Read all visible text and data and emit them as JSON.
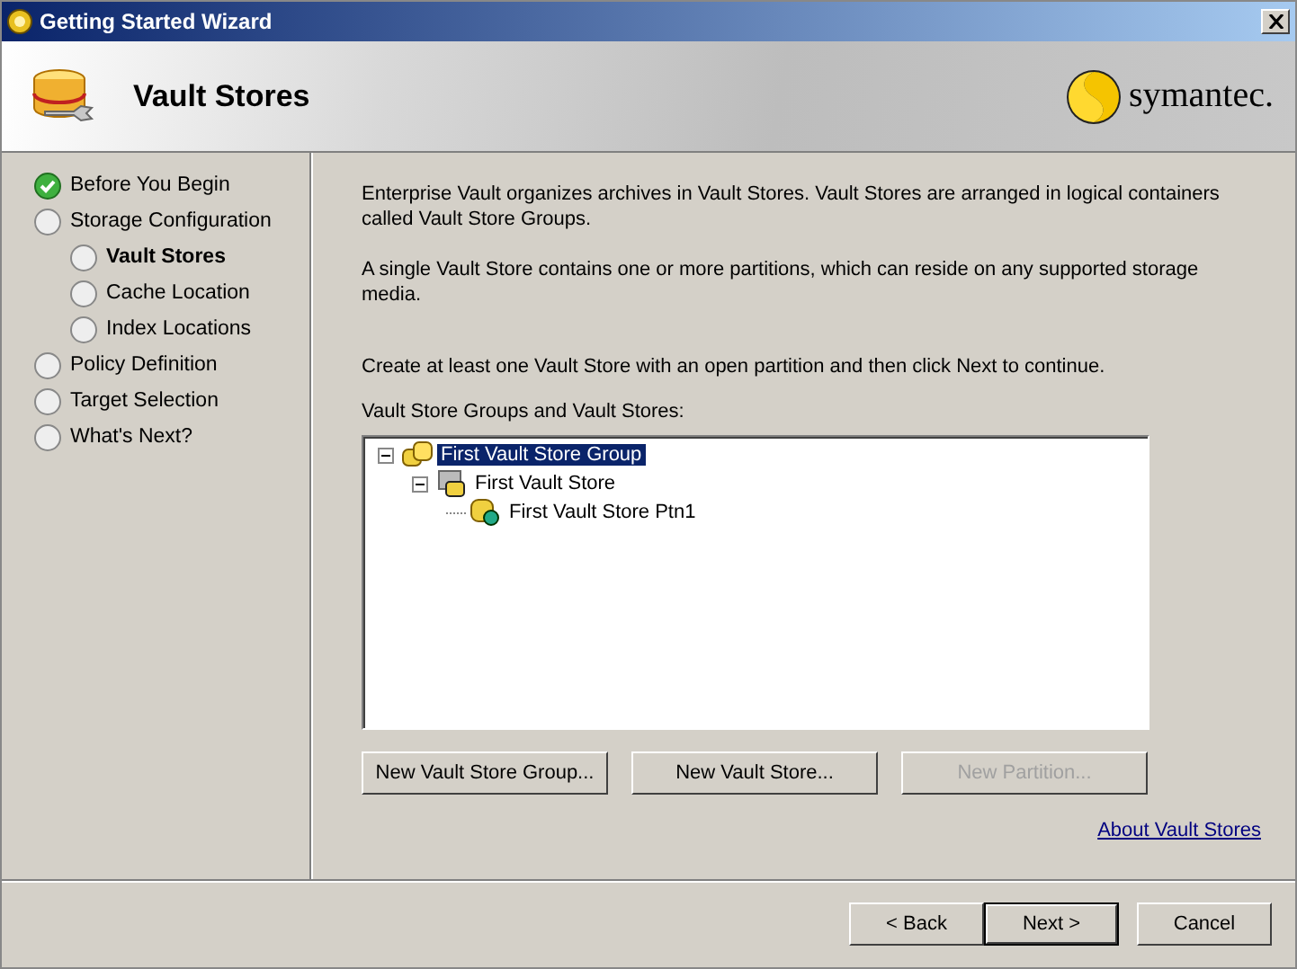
{
  "window": {
    "title": "Getting Started Wizard"
  },
  "header": {
    "title": "Vault Stores",
    "brand": "symantec."
  },
  "steps": [
    {
      "label": "Before You Begin",
      "done": true,
      "current": false
    },
    {
      "label": "Storage Configuration",
      "done": false,
      "current": false,
      "children": [
        {
          "label": "Vault Stores",
          "done": false,
          "current": true
        },
        {
          "label": "Cache Location",
          "done": false,
          "current": false
        },
        {
          "label": "Index Locations",
          "done": false,
          "current": false
        }
      ]
    },
    {
      "label": "Policy Definition",
      "done": false,
      "current": false
    },
    {
      "label": "Target Selection",
      "done": false,
      "current": false
    },
    {
      "label": "What's Next?",
      "done": false,
      "current": false
    }
  ],
  "paragraphs": [
    "Enterprise Vault organizes archives in Vault Stores. Vault Stores are arranged in logical containers called Vault Store Groups.",
    "A single Vault Store contains one or more partitions, which can reside on any supported storage media.",
    "Create at least one Vault Store with an open partition and then click Next to continue."
  ],
  "tree_label": "Vault Store Groups and Vault Stores:",
  "tree": [
    {
      "label": "First Vault Store Group",
      "kind": "group",
      "selected": true,
      "expanded": true,
      "children": [
        {
          "label": "First Vault Store",
          "kind": "store",
          "selected": false,
          "expanded": true,
          "children": [
            {
              "label": "First Vault Store Ptn1",
              "kind": "partition",
              "selected": false
            }
          ]
        }
      ]
    }
  ],
  "actions": [
    {
      "label": "New Vault Store Group...",
      "disabled": false
    },
    {
      "label": "New Vault Store...",
      "disabled": false
    },
    {
      "label": "New Partition...",
      "disabled": true
    }
  ],
  "link": "About Vault Stores",
  "footer_buttons": [
    {
      "label": "< Back",
      "default": false
    },
    {
      "label": "Next >",
      "default": true
    },
    {
      "label": "Cancel",
      "default": false
    }
  ]
}
